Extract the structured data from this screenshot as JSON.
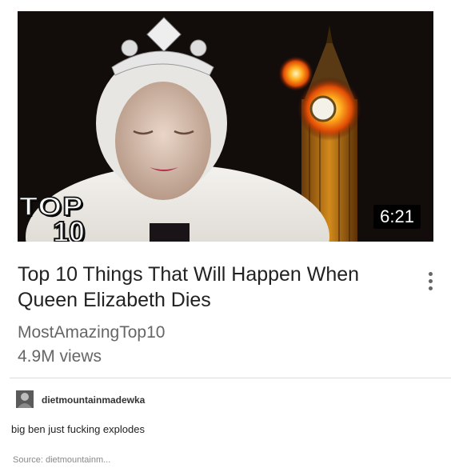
{
  "video": {
    "thumbnail_logo_line1": "TOP",
    "thumbnail_logo_line2": "10",
    "duration": "6:21",
    "title": "Top 10 Things That Will Happen When Queen Elizabeth Dies",
    "channel": "MostAmazingTop10",
    "views": "4.9M views",
    "more_icon": "vertical-ellipsis-icon"
  },
  "post": {
    "username": "dietmountainmadewka",
    "comment": "big ben just fucking explodes",
    "source": "Source: dietmountainm..."
  }
}
